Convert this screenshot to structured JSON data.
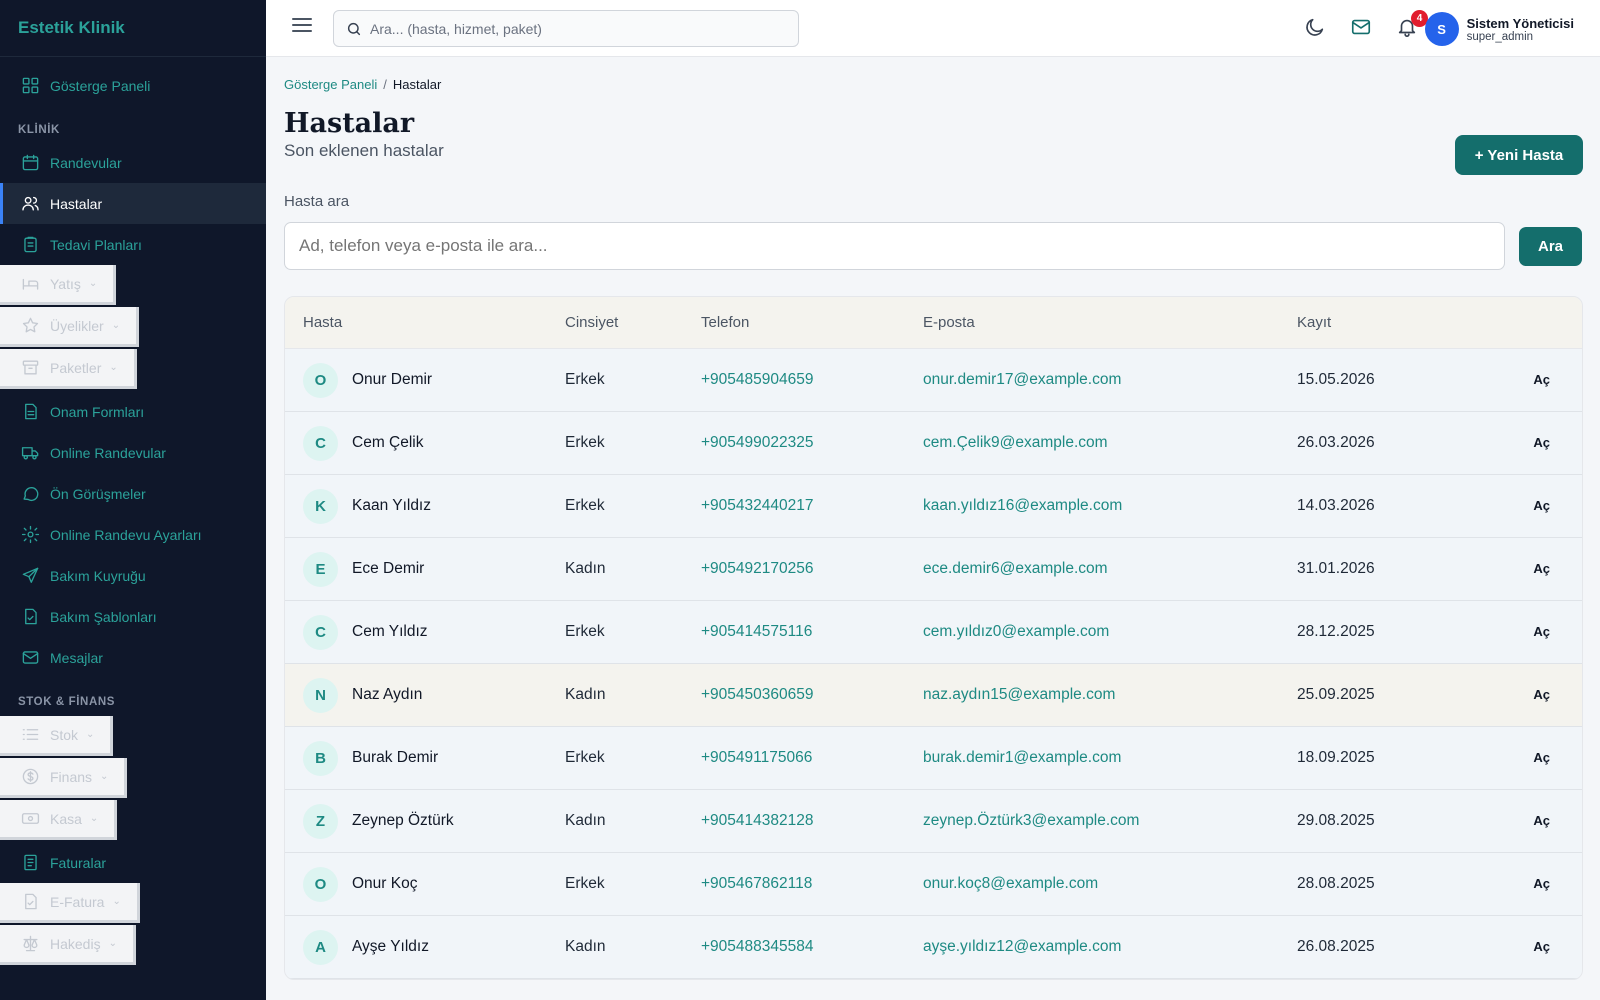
{
  "brand": "Estetik Klinik",
  "sidebar": {
    "dashboard": "Gösterge Paneli",
    "section_klinik": "KLİNİK",
    "klinik_items": [
      {
        "label": "Randevular",
        "icon": "calendar-icon"
      },
      {
        "label": "Hastalar",
        "icon": "users-icon",
        "active": true
      },
      {
        "label": "Tedavi Planları",
        "icon": "clipboard-icon"
      }
    ],
    "groups_a": [
      {
        "label": "Yatış",
        "icon": "bed-icon"
      },
      {
        "label": "Üyelikler",
        "icon": "star-icon"
      },
      {
        "label": "Paketler",
        "icon": "archive-icon"
      }
    ],
    "klinik_items_b": [
      {
        "label": "Onam Formları",
        "icon": "document-icon"
      },
      {
        "label": "Online Randevular",
        "icon": "truck-icon"
      },
      {
        "label": "Ön Görüşmeler",
        "icon": "chat-icon"
      },
      {
        "label": "Online Randevu Ayarları",
        "icon": "gear-icon"
      },
      {
        "label": "Bakım Kuyruğu",
        "icon": "send-icon"
      },
      {
        "label": "Bakım Şablonları",
        "icon": "document-check-icon"
      },
      {
        "label": "Mesajlar",
        "icon": "mail-icon"
      }
    ],
    "section_stok": "STOK & FİNANS",
    "groups_b": [
      {
        "label": "Stok",
        "icon": "list-icon"
      },
      {
        "label": "Finans",
        "icon": "dollar-icon"
      },
      {
        "label": "Kasa",
        "icon": "cash-icon"
      }
    ],
    "faturalar": "Faturalar",
    "groups_c": [
      {
        "label": "E-Fatura",
        "icon": "document-check-icon"
      },
      {
        "label": "Hakediş",
        "icon": "scale-icon"
      }
    ]
  },
  "topbar": {
    "search_placeholder": "Ara... (hasta, hizmet, paket)",
    "notification_count": "4",
    "user_initial": "S",
    "user_name": "Sistem Yöneticisi",
    "user_role": "super_admin"
  },
  "breadcrumb": {
    "parent": "Gösterge Paneli",
    "sep": "/",
    "current": "Hastalar"
  },
  "page": {
    "title": "Hastalar",
    "subtitle": "Son eklenen hastalar",
    "new_button": "+ Yeni Hasta",
    "search_label": "Hasta ara",
    "search_placeholder": "Ad, telefon veya e-posta ile ara...",
    "search_button": "Ara"
  },
  "table": {
    "headers": [
      "Hasta",
      "Cinsiyet",
      "Telefon",
      "E-posta",
      "Kayıt"
    ],
    "action_label": "Aç",
    "rows": [
      {
        "initial": "O",
        "name": "Onur Demir",
        "gender": "Erkek",
        "phone": "+905485904659",
        "email": "onur.demir17@example.com",
        "date": "15.05.2026"
      },
      {
        "initial": "C",
        "name": "Cem Çelik",
        "gender": "Erkek",
        "phone": "+905499022325",
        "email": "cem.Çelik9@example.com",
        "date": "26.03.2026"
      },
      {
        "initial": "K",
        "name": "Kaan Yıldız",
        "gender": "Erkek",
        "phone": "+905432440217",
        "email": "kaan.yıldız16@example.com",
        "date": "14.03.2026"
      },
      {
        "initial": "E",
        "name": "Ece Demir",
        "gender": "Kadın",
        "phone": "+905492170256",
        "email": "ece.demir6@example.com",
        "date": "31.01.2026"
      },
      {
        "initial": "C",
        "name": "Cem Yıldız",
        "gender": "Erkek",
        "phone": "+905414575116",
        "email": "cem.yıldız0@example.com",
        "date": "28.12.2025"
      },
      {
        "initial": "N",
        "name": "Naz Aydın",
        "gender": "Kadın",
        "phone": "+905450360659",
        "email": "naz.aydın15@example.com",
        "date": "25.09.2025"
      },
      {
        "initial": "B",
        "name": "Burak Demir",
        "gender": "Erkek",
        "phone": "+905491175066",
        "email": "burak.demir1@example.com",
        "date": "18.09.2025"
      },
      {
        "initial": "Z",
        "name": "Zeynep Öztürk",
        "gender": "Kadın",
        "phone": "+905414382128",
        "email": "zeynep.Öztürk3@example.com",
        "date": "29.08.2025"
      },
      {
        "initial": "O",
        "name": "Onur Koç",
        "gender": "Erkek",
        "phone": "+905467862118",
        "email": "onur.koç8@example.com",
        "date": "28.08.2025"
      },
      {
        "initial": "A",
        "name": "Ayşe Yıldız",
        "gender": "Kadın",
        "phone": "+905488345584",
        "email": "ayşe.yıldız12@example.com",
        "date": "26.08.2025"
      }
    ]
  }
}
